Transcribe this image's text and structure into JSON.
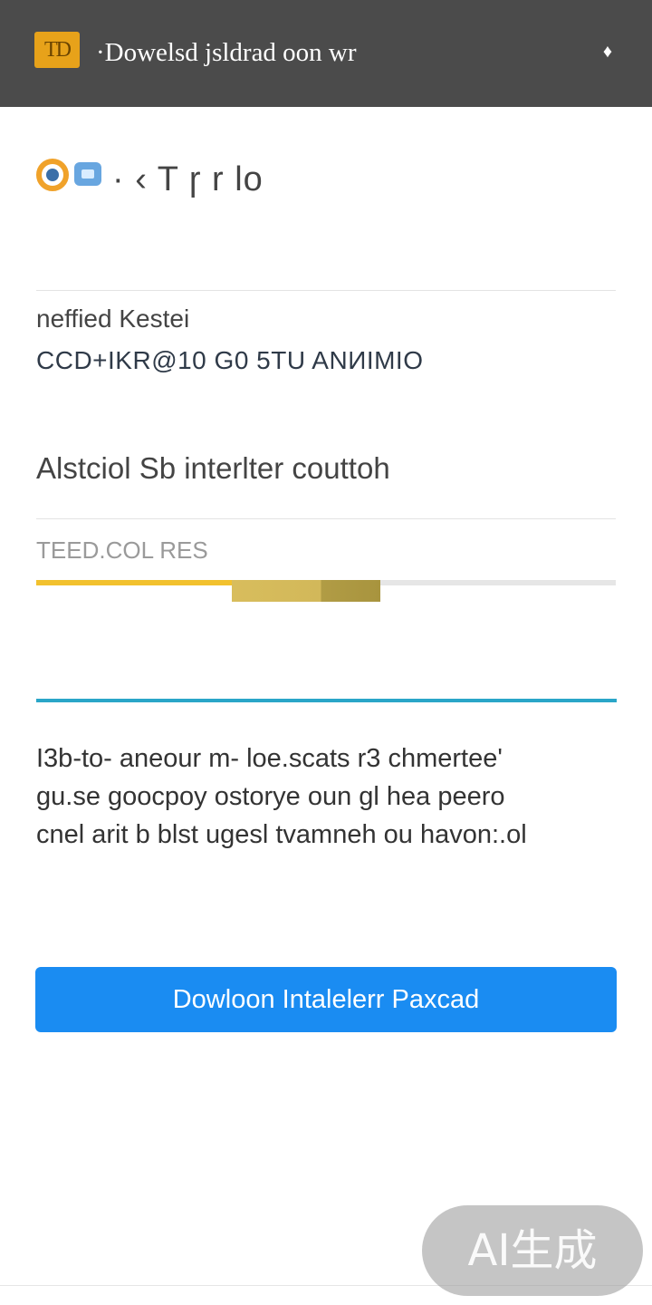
{
  "window": {
    "logo_text": "TD",
    "title": "·Dowelsd jsldrad oon wr",
    "menu_icon": "diamond-icon"
  },
  "brand": {
    "icons": [
      "ring-logo-icon",
      "square-logo-icon"
    ],
    "text": "· ‹ T ɼ r lo"
  },
  "verification": {
    "label": "neffied Kestei",
    "value": "CCD+IKR@10 G0 5TU  ANИIMIO"
  },
  "section": {
    "heading": "Alstciol Sb interlter couttoh"
  },
  "progress": {
    "label": "TEED.COL  RES",
    "fraction": 0.58
  },
  "description": {
    "lines": [
      "I3b-to- aneour m- loe.scats r3 chmertee'",
      "gu.se goocpoy ostorye oun gl hea peero",
      "cnel arit b blst ugesl tvamneh ou havon:.ol"
    ]
  },
  "actions": {
    "download_label": "Dowloon Intalelerr Paxcad"
  },
  "watermark": {
    "text": "AI生成"
  },
  "colors": {
    "titlebar": "#4b4b4b",
    "logo": "#e7a21a",
    "progress": "#f2c12e",
    "accent_rule": "#2aa6c8",
    "button": "#1a8cf2"
  }
}
